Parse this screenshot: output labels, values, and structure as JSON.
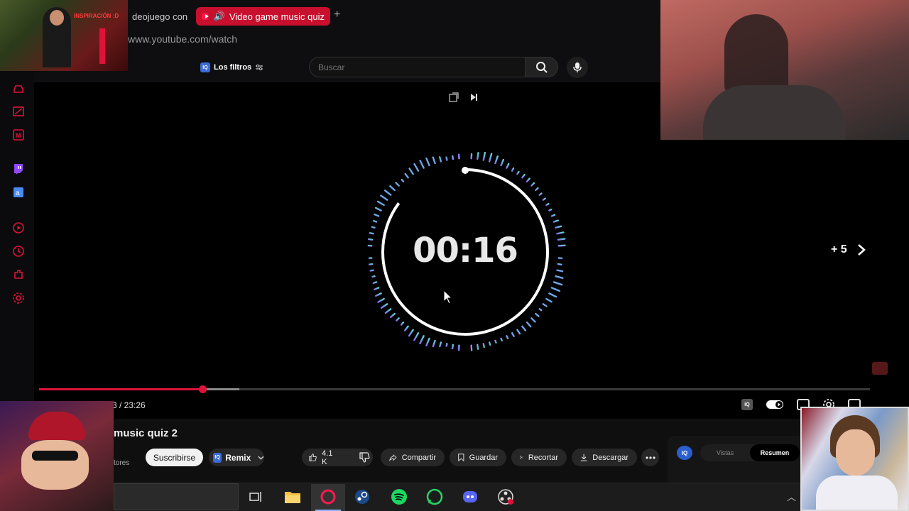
{
  "browser": {
    "tabs": [
      {
        "label": "deojuego con l"
      },
      {
        "label": "Video game music quiz"
      }
    ],
    "new_tab_label": "+",
    "address": "www.youtube.com/watch"
  },
  "header": {
    "filters_label": "Los filtros",
    "iq_badge": "IQ",
    "search_placeholder": "Buscar"
  },
  "player": {
    "timer": "00:16",
    "skip_label": "+ 5",
    "time_display": "3 / 23:26",
    "progress_played_fraction": 0.197,
    "progress_buffered_fraction": 0.241
  },
  "video": {
    "title": "music quiz 2",
    "subscribers_fragment": "tores"
  },
  "actions": {
    "subscribe": "Suscribirse",
    "remix": "Remix",
    "likes": "4.1 K",
    "share": "Compartir",
    "save": "Guardar",
    "clip": "Recortar",
    "download": "Descargar"
  },
  "side_panel": {
    "iq_badge": "IQ",
    "tabs": [
      "Vistas",
      "Resumen"
    ],
    "active_tab": "Resumen"
  },
  "overlays": {
    "thumb_caption": "INSPIRACIÓN :D"
  },
  "colors": {
    "accent_red": "#e0123a",
    "tab_active": "#c8102e",
    "ring_gradient_start": "#8a6cf0",
    "ring_gradient_end": "#5ed6d0"
  }
}
